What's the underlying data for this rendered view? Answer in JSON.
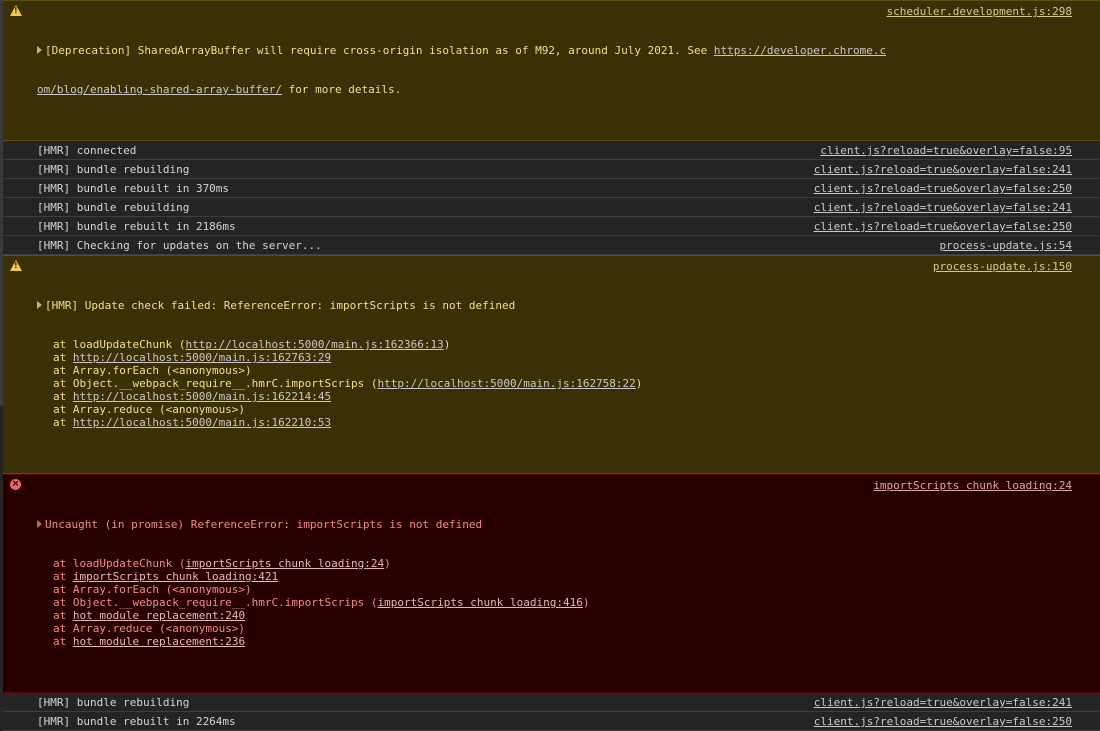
{
  "colors": {
    "background": "#242424",
    "warning_bg": "#3a3006",
    "warning_text": "#f6df8d",
    "error_bg": "#290000",
    "error_text": "#f28b82"
  },
  "deprecation": {
    "icon": "warning-icon",
    "line1_text": "[Deprecation] SharedArrayBuffer will require cross-origin isolation as of M92, around July 2021. See ",
    "link_part1": "https://developer.chrome.c",
    "link_part2": "om/blog/enabling-shared-array-buffer/",
    "line2_suffix": " for more details.",
    "source": "scheduler.development.js:298"
  },
  "messages_top": [
    {
      "text": "[HMR] connected",
      "source": "client.js?reload=true&overlay=false:95"
    },
    {
      "text": "[HMR] bundle rebuilding",
      "source": "client.js?reload=true&overlay=false:241"
    },
    {
      "text": "[HMR] bundle rebuilt in 370ms",
      "source": "client.js?reload=true&overlay=false:250"
    },
    {
      "text": "[HMR] bundle rebuilding",
      "source": "client.js?reload=true&overlay=false:241"
    },
    {
      "text": "[HMR] bundle rebuilt in 2186ms",
      "source": "client.js?reload=true&overlay=false:250"
    },
    {
      "text": "[HMR] Checking for updates on the server...",
      "source": "process-update.js:54"
    }
  ],
  "update_warning": {
    "icon": "warning-icon",
    "text": "[HMR] Update check failed: ReferenceError: importScripts is not defined",
    "source": "process-update.js:150",
    "stack": [
      {
        "prefix": "at loadUpdateChunk (",
        "link": "http://localhost:5000/main.js:162366:13",
        "suffix": ")"
      },
      {
        "prefix": "at ",
        "link": "http://localhost:5000/main.js:162763:29",
        "suffix": ""
      },
      {
        "prefix": "at Array.forEach (<anonymous>)",
        "link": "",
        "suffix": ""
      },
      {
        "prefix": "at Object.__webpack_require__.hmrC.importScrips (",
        "link": "http://localhost:5000/main.js:162758:22",
        "suffix": ")"
      },
      {
        "prefix": "at ",
        "link": "http://localhost:5000/main.js:162214:45",
        "suffix": ""
      },
      {
        "prefix": "at Array.reduce (<anonymous>)",
        "link": "",
        "suffix": ""
      },
      {
        "prefix": "at ",
        "link": "http://localhost:5000/main.js:162210:53",
        "suffix": ""
      }
    ]
  },
  "uncaught_error": {
    "icon": "error-icon",
    "text": "Uncaught (in promise) ReferenceError: importScripts is not defined",
    "source": "importScripts chunk loading:24",
    "stack": [
      {
        "prefix": "at loadUpdateChunk (",
        "link": "importScripts chunk loading:24",
        "suffix": ")"
      },
      {
        "prefix": "at ",
        "link": "importScripts chunk loading:421",
        "suffix": ""
      },
      {
        "prefix": "at Array.forEach (<anonymous>)",
        "link": "",
        "suffix": ""
      },
      {
        "prefix": "at Object.__webpack_require__.hmrC.importScrips (",
        "link": "importScripts chunk loading:416",
        "suffix": ")"
      },
      {
        "prefix": "at ",
        "link": "hot module replacement:240",
        "suffix": ""
      },
      {
        "prefix": "at Array.reduce (<anonymous>)",
        "link": "",
        "suffix": ""
      },
      {
        "prefix": "at ",
        "link": "hot module replacement:236",
        "suffix": ""
      }
    ]
  },
  "messages_bottom": [
    {
      "text": "[HMR] bundle rebuilding",
      "source": "client.js?reload=true&overlay=false:241"
    },
    {
      "text": "[HMR] bundle rebuilt in 2264ms",
      "source": "client.js?reload=true&overlay=false:250"
    }
  ]
}
